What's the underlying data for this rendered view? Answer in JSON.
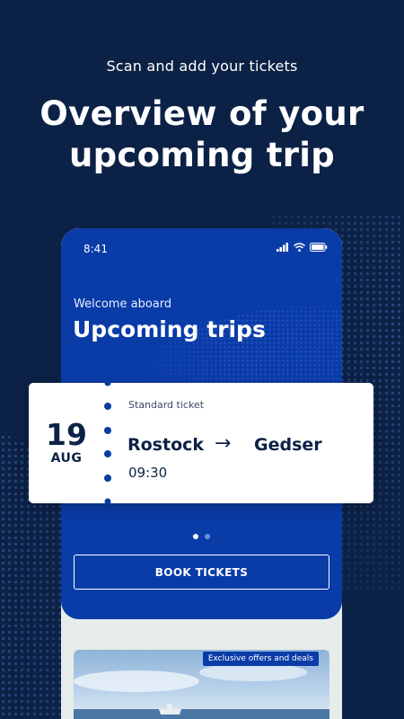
{
  "promo": {
    "subtitle": "Scan and add your tickets",
    "title": "Overview of your upcoming trip"
  },
  "phone": {
    "status_time": "8:41",
    "welcome": "Welcome aboard",
    "heading": "Upcoming trips",
    "book_button": "BOOK TICKETS",
    "offer_badge": "Exclusive offers and deals",
    "pager": {
      "total": 2,
      "active": 1
    }
  },
  "ticket": {
    "day": "19",
    "month": "AUG",
    "type": "Standard ticket",
    "from": "Rostock",
    "arrow": "→",
    "to": "Gedser",
    "time": "09:30"
  },
  "colors": {
    "background": "#0c2146",
    "brand_blue": "#0a3ca8",
    "ticket_text": "#0c2146"
  },
  "icons": [
    "signal-icon",
    "wifi-icon",
    "battery-icon",
    "arrow-right-icon"
  ]
}
